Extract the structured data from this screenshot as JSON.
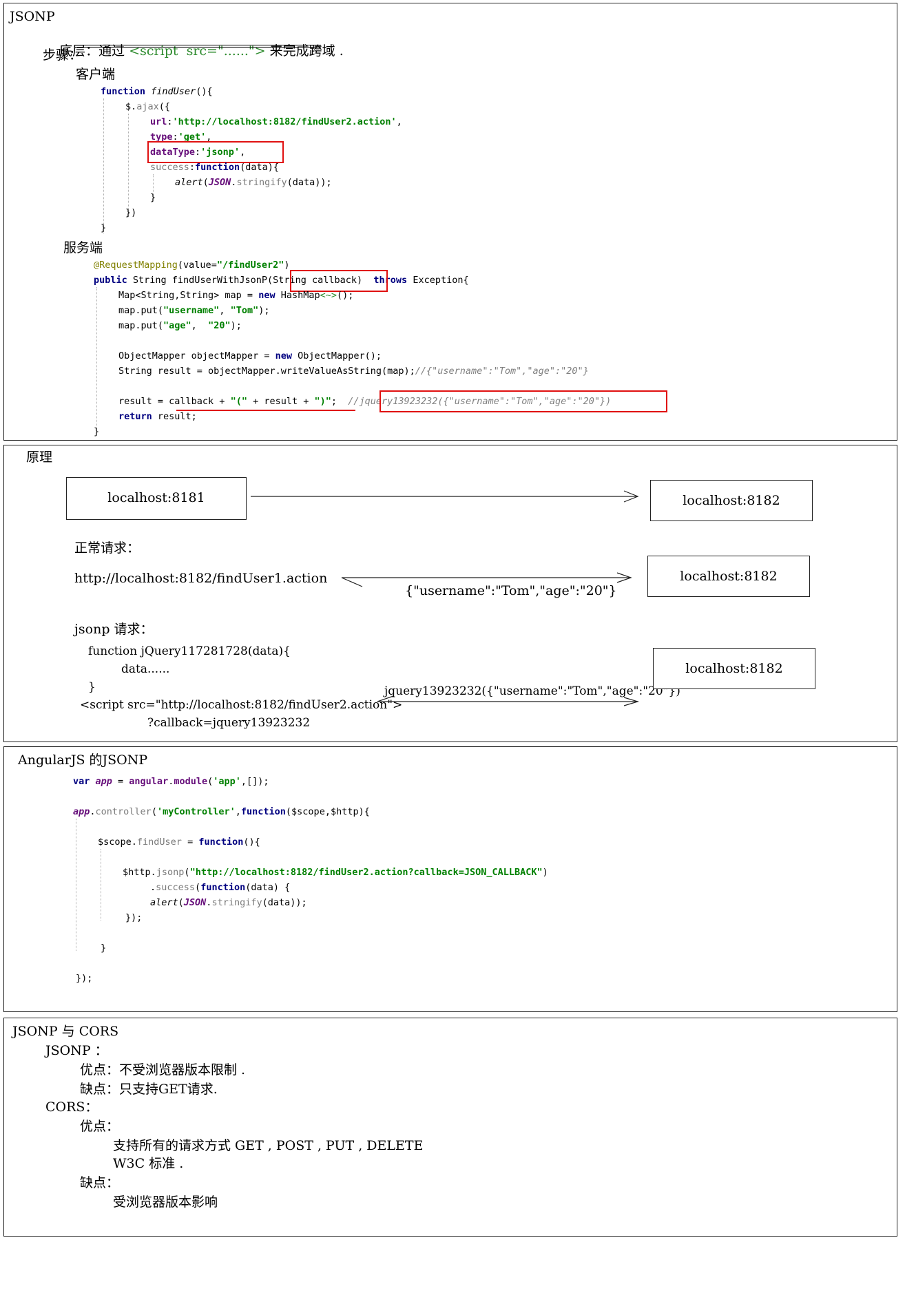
{
  "p1": {
    "title": "JSONP",
    "base_label": "底层：通过 ",
    "base_code": "<script  src=\"......\">",
    "base_suffix": " 来完成跨域 .",
    "steps": "步骤：",
    "client_label": "客户端",
    "client_code": [
      "function findUser(){",
      "$.ajax({",
      "url:'http://localhost:8182/findUser2.action',",
      "type:'get',",
      "dataType:'jsonp',",
      "success:function(data){",
      "alert(JSON.stringify(data));",
      "}",
      "})",
      "}"
    ],
    "server_label": "服务端",
    "server_code": [
      "@RequestMapping(value=\"/findUser2\")",
      "public String findUserWithJsonP(String callback)  throws Exception{",
      "Map<String,String> map = new HashMap<~>();",
      "map.put(\"username\", \"Tom\");",
      "map.put(\"age\",  \"20\");",
      "ObjectMapper objectMapper = new ObjectMapper();",
      "String result = objectMapper.writeValueAsString(map);//{\"username\":\"Tom\",\"age\":\"20\"}",
      "result = callback + \"(\" + result + \")\";  //jquery13923232({\"username\":\"Tom\",\"age\":\"20\"})",
      "return result;",
      "}"
    ]
  },
  "p2": {
    "title": "原理",
    "host_a": "localhost:8181",
    "host_b": "localhost:8182",
    "normal_label": "正常请求：",
    "normal_url": "http://localhost:8182/findUser1.action",
    "normal_resp": "{\"username\":\"Tom\",\"age\":\"20\"}",
    "host_c": "localhost:8182",
    "jsonp_label": "jsonp 请求：",
    "fn_line1": "function jQuery117281728(data){",
    "fn_line2": "data......",
    "fn_line3": "}",
    "script_line1": "<script src=\"http://localhost:8182/findUser2.action\">",
    "script_line2": "?callback=jquery13923232",
    "jsonp_resp": "jquery13923232({\"username\":\"Tom\",\"age\":\"20\"})",
    "host_d": "localhost:8182"
  },
  "p3": {
    "title": "AngularJS 的JSONP",
    "code": [
      "var app = angular.module('app',[]);",
      "app.controller('myController',function($scope,$http){",
      "$scope.findUser = function(){",
      "$http.jsonp(\"http://localhost:8182/findUser2.action?callback=JSON_CALLBACK\")",
      ".success(function(data) {",
      "alert(JSON.stringify(data));",
      "});",
      "}",
      "});"
    ]
  },
  "p4": {
    "title": "JSONP 与 CORS",
    "jsonp": "JSONP ：",
    "jsonp_pro": "优点：不受浏览器版本限制 .",
    "jsonp_con": "缺点：只支持GET请求.",
    "cors": "CORS：",
    "cors_pro": "优点：",
    "cors_pro1": "支持所有的请求方式 GET , POST , PUT , DELETE",
    "cors_pro2": "W3C 标准 .",
    "cors_con": "缺点：",
    "cors_con1": "受浏览器版本影响"
  }
}
